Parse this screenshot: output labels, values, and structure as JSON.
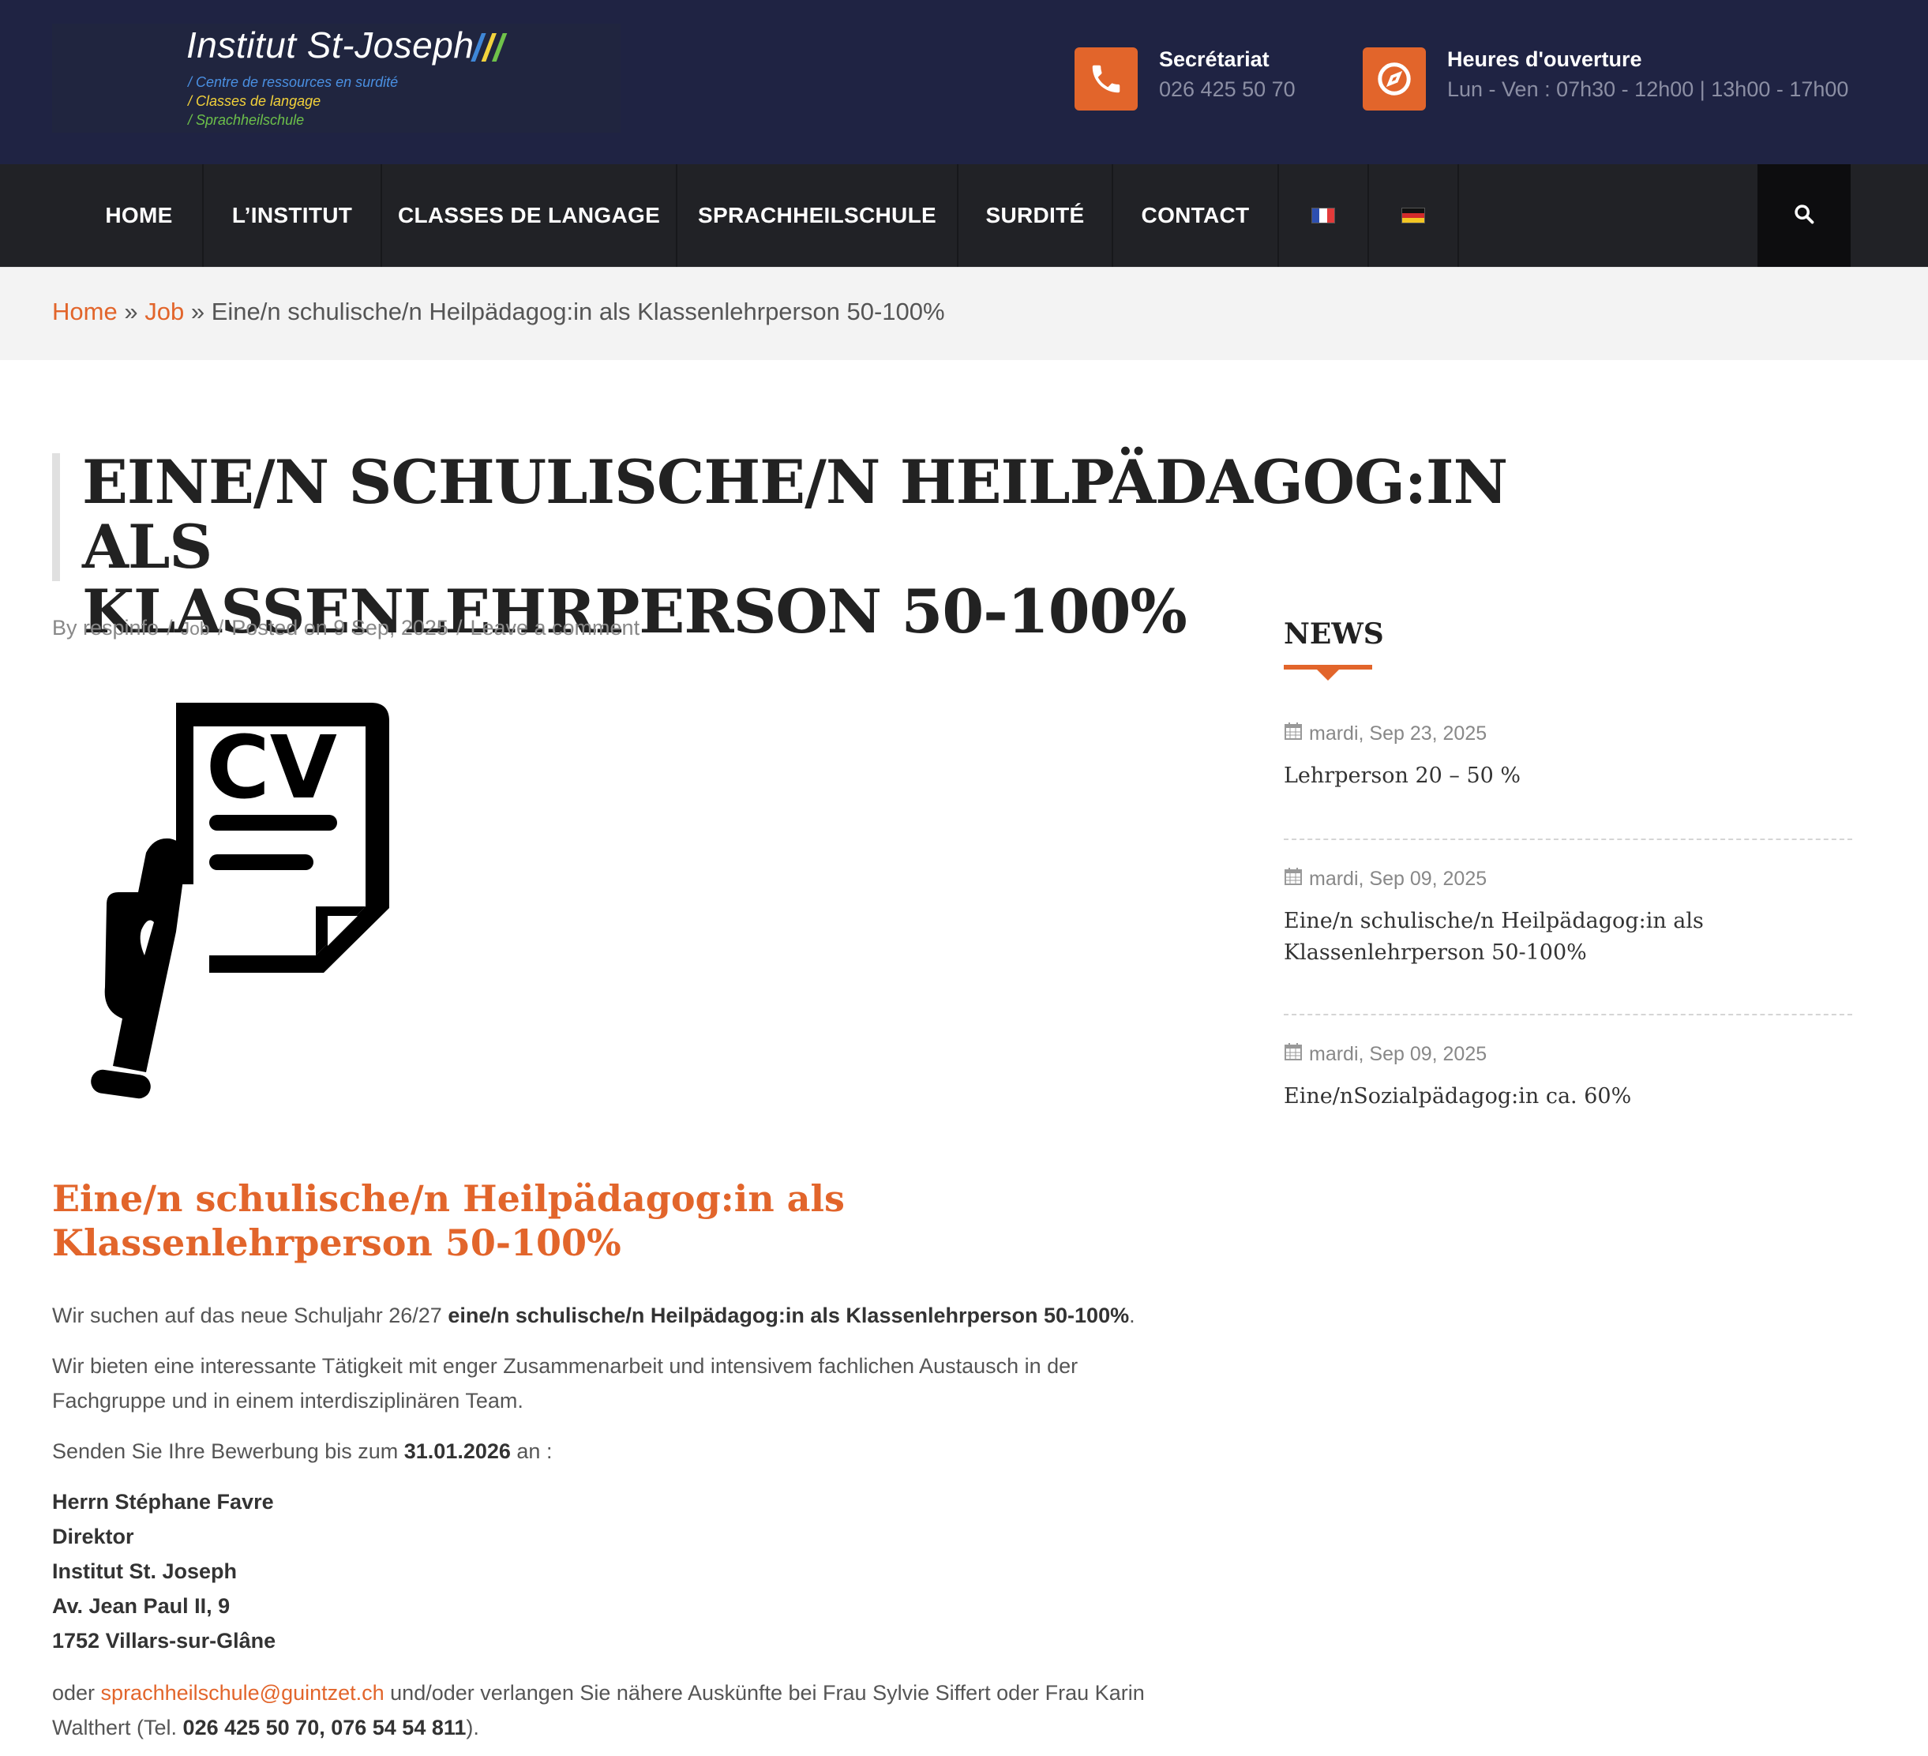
{
  "header": {
    "logo_title": "Institut St-Joseph",
    "logo_marks": "///",
    "logo_subtitles": [
      "/ Centre de ressources en surdité",
      "/ Classes de langage",
      "/ Sprachheilschule"
    ],
    "phone_label": "Secrétariat",
    "phone_value": "026 425 50 70",
    "hours_label": "Heures d'ouverture",
    "hours_value": "Lun - Ven : 07h30 - 12h00 | 13h00 - 17h00"
  },
  "nav": {
    "items": [
      "HOME",
      "L’INSTITUT",
      "CLASSES DE LANGAGE",
      "SPRACHHEILSCHULE",
      "SURDITÉ",
      "CONTACT"
    ],
    "flags": [
      "french-flag-icon",
      "german-flag-icon"
    ]
  },
  "breadcrumb": {
    "home": "Home",
    "sep": "»",
    "category": "Job",
    "current": "Eine/n schulische/n Heilpädagog:in als Klassenlehrperson 50-100%"
  },
  "article": {
    "title_line1": "EINE/N SCHULISCHE/N HEILPÄDAGOG:IN ALS",
    "title_line2": "KLASSENLEHRPERSON 50-100%",
    "meta_author": "By respinfo",
    "meta_category": "Job",
    "meta_posted": "Posted on 9 Sep, 2025",
    "meta_comment": "Leave a comment",
    "meta_sep": "/",
    "heading": "Eine/n schulische/n Heilpädagog:in als Klassenlehrperson 50-100%",
    "p1_a": "Wir suchen auf das neue Schuljahr 26/27 ",
    "p1_b": "eine/n schulische/n Heilpädagog:in als Klassenlehrperson 50-100%",
    "p1_c": ".",
    "p2": "Wir bieten eine interessante Tätigkeit mit enger Zusammenarbeit und intensivem fachlichen Austausch in der Fachgruppe und in einem interdisziplinären Team.",
    "p3_a": "Senden Sie Ihre Bewerbung bis zum ",
    "p3_b": "31.01.2026",
    "p3_c": " an :",
    "address": [
      "Herrn Stéphane Favre",
      "Direktor",
      "Institut St. Joseph",
      "Av. Jean Paul II, 9",
      "1752 Villars-sur-Glâne"
    ],
    "p4_a": "oder ",
    "p4_email": "sprachheilschule@guintzet.ch",
    "p4_b": " und/oder verlangen Sie nähere Auskünfte bei Frau Sylvie Siffert oder Frau Karin Walthert (Tel. ",
    "p4_phones": "026 425 50 70, 076 54 54 811",
    "p4_c": ")."
  },
  "sidebar": {
    "title": "NEWS",
    "items": [
      {
        "date": "mardi, Sep 23, 2025",
        "title": "Lehrperson 20 – 50 %"
      },
      {
        "date": "mardi, Sep 09, 2025",
        "title": "Eine/n schulische/n Heilpädagog:in als Klassenlehrperson 50-100%"
      },
      {
        "date": "mardi, Sep 09, 2025",
        "title": "Eine/nSozialpädagog:in ca. 60%"
      }
    ]
  },
  "colors": {
    "accent": "#e2652b",
    "header_bg": "#1f2343",
    "nav_bg": "#212226"
  }
}
